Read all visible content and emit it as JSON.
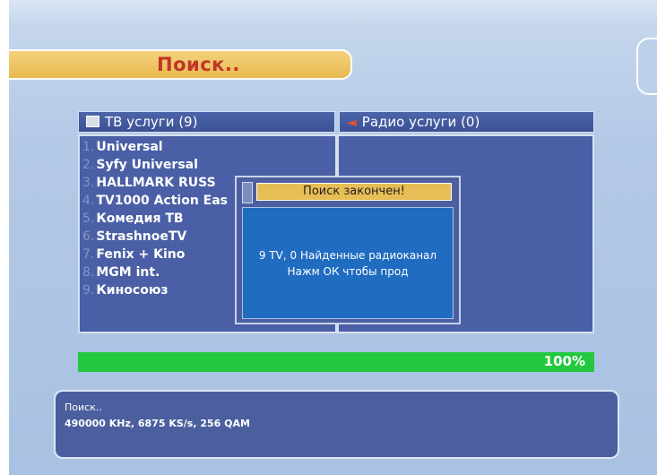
{
  "header": {
    "title": "Поиск.."
  },
  "tv_panel": {
    "title": "ТВ услуги (9)",
    "channels": [
      {
        "num": "1.",
        "name": "Universal"
      },
      {
        "num": "2.",
        "name": "Syfy Universal"
      },
      {
        "num": "3.",
        "name": "HALLMARK RUSS"
      },
      {
        "num": "4.",
        "name": "TV1000 Action Eas"
      },
      {
        "num": "5.",
        "name": "Комедия ТВ"
      },
      {
        "num": "6.",
        "name": "StrashnoeTV"
      },
      {
        "num": "7.",
        "name": "Fenix + Kino"
      },
      {
        "num": "8.",
        "name": "MGM int."
      },
      {
        "num": "9.",
        "name": "Киносоюз"
      }
    ]
  },
  "radio_panel": {
    "title": "Радио услуги (0)"
  },
  "dialog": {
    "title": "Поиск закончен!",
    "line1": "9 TV, 0 Найденные радиоканал",
    "line2": "Нажм ОК чтобы прод"
  },
  "progress": {
    "percent": 100,
    "label": "100%"
  },
  "status": {
    "line1": "Поиск..",
    "line2": "490000 KHz, 6875 KS/s, 256 QAM"
  },
  "colors": {
    "title_bg": "#e9b94e",
    "title_text": "#c0352a",
    "panel_bg": "#4a5fa5",
    "dialog_body": "#1f6cc1",
    "progress_fill": "#22c93e"
  },
  "icons": {
    "tv": "tv-icon",
    "radio": "speaker-icon"
  }
}
